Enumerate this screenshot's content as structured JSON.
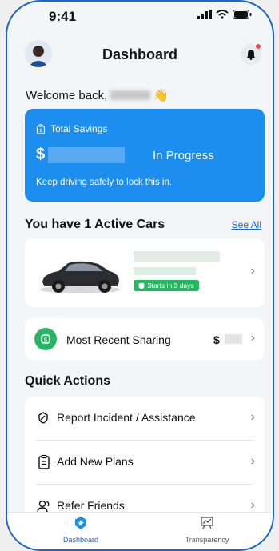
{
  "status": {
    "time": "9:41"
  },
  "header": {
    "title": "Dashboard"
  },
  "welcome": {
    "prefix": "Welcome back,",
    "emoji": "👋"
  },
  "savings": {
    "label": "Total Savings",
    "currency": "$",
    "status": "In Progress",
    "note": "Keep driving safely to lock this in."
  },
  "cars": {
    "title": "You have 1 Active Cars",
    "see_all": "See All",
    "badge": "Starts in 3 days"
  },
  "sharing": {
    "label": "Most Recent Sharing",
    "currency": "$"
  },
  "quick_actions": {
    "title": "Quick Actions",
    "items": [
      {
        "label": "Report Incident / Assistance",
        "icon": "hand-shield-icon"
      },
      {
        "label": "Add New Plans",
        "icon": "clipboard-icon"
      },
      {
        "label": "Refer Friends",
        "icon": "people-icon"
      }
    ]
  },
  "tabs": [
    {
      "label": "Dashboard",
      "icon": "star-badge-icon",
      "active": true
    },
    {
      "label": "Transparency",
      "icon": "chart-board-icon",
      "active": false
    }
  ],
  "colors": {
    "accent": "#1b8ef0",
    "brand": "#1a66c8",
    "success": "#28b561",
    "alert": "#ef4b4b"
  }
}
